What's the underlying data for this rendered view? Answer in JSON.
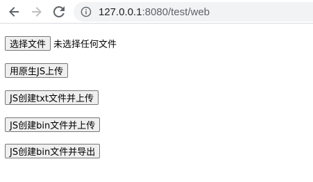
{
  "browser": {
    "url_host": "127.0.0.1",
    "url_rest": ":8080/test/web",
    "icons": {
      "back": "arrow-left-icon",
      "forward": "arrow-right-icon",
      "reload": "reload-icon",
      "info": "info-circle-icon"
    },
    "colors": {
      "icon_active": "#5f6368",
      "icon_disabled": "#c0c0c0"
    }
  },
  "page": {
    "file_input": {
      "button_label": "选择文件",
      "status_text": "未选择任何文件"
    },
    "buttons": {
      "native_upload": "用原生JS上传",
      "create_txt_upload": "JS创建txt文件并上传",
      "create_bin_upload": "JS创建bin文件并上传",
      "create_bin_export": "JS创建bin文件并导出"
    }
  }
}
